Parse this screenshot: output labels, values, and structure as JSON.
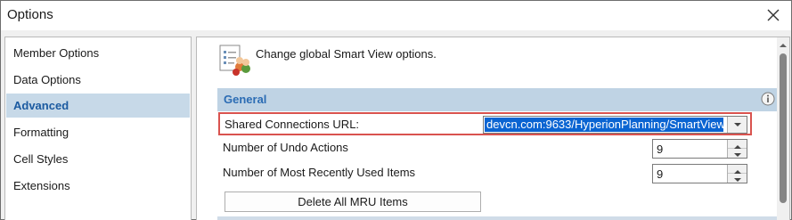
{
  "window": {
    "title": "Options"
  },
  "sidebar": {
    "items": [
      {
        "label": "Member Options",
        "active": false
      },
      {
        "label": "Data Options",
        "active": false
      },
      {
        "label": "Advanced",
        "active": true
      },
      {
        "label": "Formatting",
        "active": false
      },
      {
        "label": "Cell Styles",
        "active": false
      },
      {
        "label": "Extensions",
        "active": false
      }
    ]
  },
  "content": {
    "header_text": "Change global Smart View options.",
    "section": {
      "title": "General"
    },
    "shared_connections": {
      "label": "Shared Connections URL:",
      "value": "devcn.com:9633/HyperionPlanning/SmartView"
    },
    "undo_actions": {
      "label": "Number of Undo Actions",
      "value": "9"
    },
    "mru_items": {
      "label": "Number of Most Recently Used Items",
      "value": "9"
    },
    "delete_mru_button": "Delete All MRU Items"
  },
  "colors": {
    "accent": "#2b6cb4",
    "selection": "#0a64d2",
    "highlight_border": "#d9534f",
    "section_bg": "#bfd3e4"
  }
}
